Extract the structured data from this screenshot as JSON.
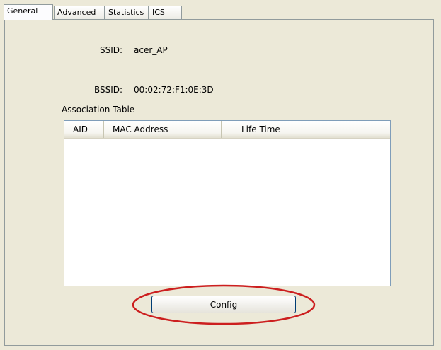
{
  "tabs": [
    {
      "label": "General",
      "active": true
    },
    {
      "label": "Advanced",
      "active": false
    },
    {
      "label": "Statistics",
      "active": false
    },
    {
      "label": "ICS",
      "active": false
    }
  ],
  "general": {
    "ssid_label": "SSID:",
    "ssid_value": "acer_AP",
    "bssid_label": "BSSID:",
    "bssid_value": "00:02:72:F1:0E:3D",
    "association_table_label": "Association Table"
  },
  "association_table": {
    "columns": [
      "AID",
      "MAC Address",
      "Life Time"
    ],
    "rows": []
  },
  "config_button": {
    "label": "Config"
  },
  "colors": {
    "highlight": "#cc1f1f",
    "window_bg": "#ece9d8"
  }
}
